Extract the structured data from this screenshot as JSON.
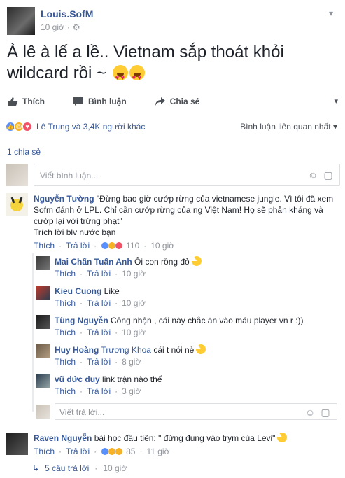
{
  "post": {
    "author": "Louis.SofM",
    "time": "10 giờ",
    "text": "À lê à lế a lề.. Vietnam sắp thoát khỏi wildcard rồi ~",
    "emoji_icon": "heart-eyes-emoji"
  },
  "actions": {
    "like": "Thích",
    "comment": "Bình luận",
    "share": "Chia sẻ"
  },
  "reactions": {
    "names": "Lê Trung và 3,4K người khác",
    "sort": "Bình luận liên quan nhất"
  },
  "shares": "1 chia sẻ",
  "composer": {
    "placeholder": "Viết bình luận..."
  },
  "comments": [
    {
      "name": "Nguyễn Tường",
      "text": "\"Đừng bao giờ cướp rừng của vietnamese jungle. Vì tôi đã xem Sofm đánh ở LPL. Chỉ cần cướp rừng của ng Việt Nam! Họ sẽ phản kháng và cướp lại với trừng phạt\"",
      "text2": "Trích lời blv nước bạn",
      "like": "Thích",
      "reply": "Trả lời",
      "reaction_count": "110",
      "time": "10 giờ",
      "replies": [
        {
          "name": "Mai Chấn Tuấn Anh",
          "text": "Ôi con rồng đỏ",
          "like": "Thích",
          "reply": "Trả lời",
          "time": "10 giờ"
        },
        {
          "name": "Kieu Cuong",
          "text": "Like",
          "like": "Thích",
          "reply": "Trả lời",
          "time": "10 giờ"
        },
        {
          "name": "Tùng Nguyễn",
          "text": "Công nhận , cái này chắc ăn vào máu player vn r :))",
          "like": "Thích",
          "reply": "Trả lời",
          "time": "10 giờ"
        },
        {
          "name": "Huy Hoàng",
          "mention": "Trương Khoa",
          "text": "cái t nói nè",
          "like": "Thích",
          "reply": "Trả lời",
          "time": "8 giờ"
        },
        {
          "name": "vũ đức duy",
          "text": "link trận nào thế",
          "like": "Thích",
          "reply": "Trả lời",
          "time": "3 giờ"
        }
      ],
      "reply_placeholder": "Viết trả lời..."
    },
    {
      "name": "Raven Nguyễn",
      "text": "bài học đầu tiên: \" đừng đụng vào trym của Levi\"",
      "like": "Thích",
      "reply": "Trả lời",
      "reaction_count": "85",
      "time": "11 giờ",
      "more_replies": "5 câu trả lời",
      "more_time": "10 giờ"
    }
  ],
  "colors": {
    "link": "#365899",
    "muted": "#90949c",
    "like_blue": "#5890ff",
    "haha_yellow": "#f7b125",
    "love_red": "#f25268"
  }
}
